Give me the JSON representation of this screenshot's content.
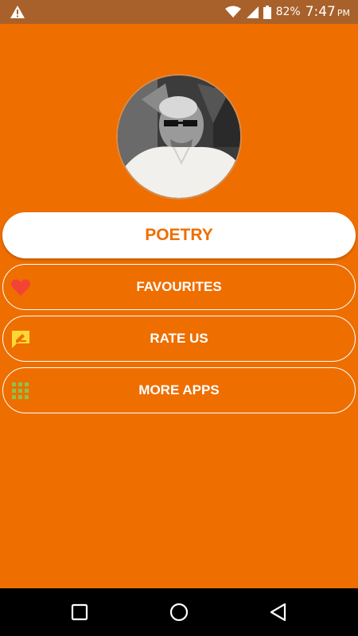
{
  "status_bar": {
    "battery": "82%",
    "time": "7:47",
    "ampm": "PM",
    "icons": [
      "warning-icon",
      "wifi-icon",
      "signal-icon",
      "battery-icon"
    ]
  },
  "menu": {
    "primary": {
      "label": "POETRY"
    },
    "items": [
      {
        "label": "FAVOURITES",
        "icon": "heart-icon",
        "icon_color": "#f44336"
      },
      {
        "label": "RATE US",
        "icon": "rate-pencil-icon",
        "icon_color": "#fdd835"
      },
      {
        "label": "MORE APPS",
        "icon": "grid-apps-icon",
        "icon_color": "#8bc34a"
      }
    ]
  },
  "nav": {
    "icons": [
      "recents-square-icon",
      "home-circle-icon",
      "back-triangle-icon"
    ]
  },
  "colors": {
    "background": "#ee6e00",
    "status_bar": "#a8612a",
    "primary_button": "#ffffff",
    "primary_text": "#ee6e00",
    "nav_bar": "#000000"
  }
}
